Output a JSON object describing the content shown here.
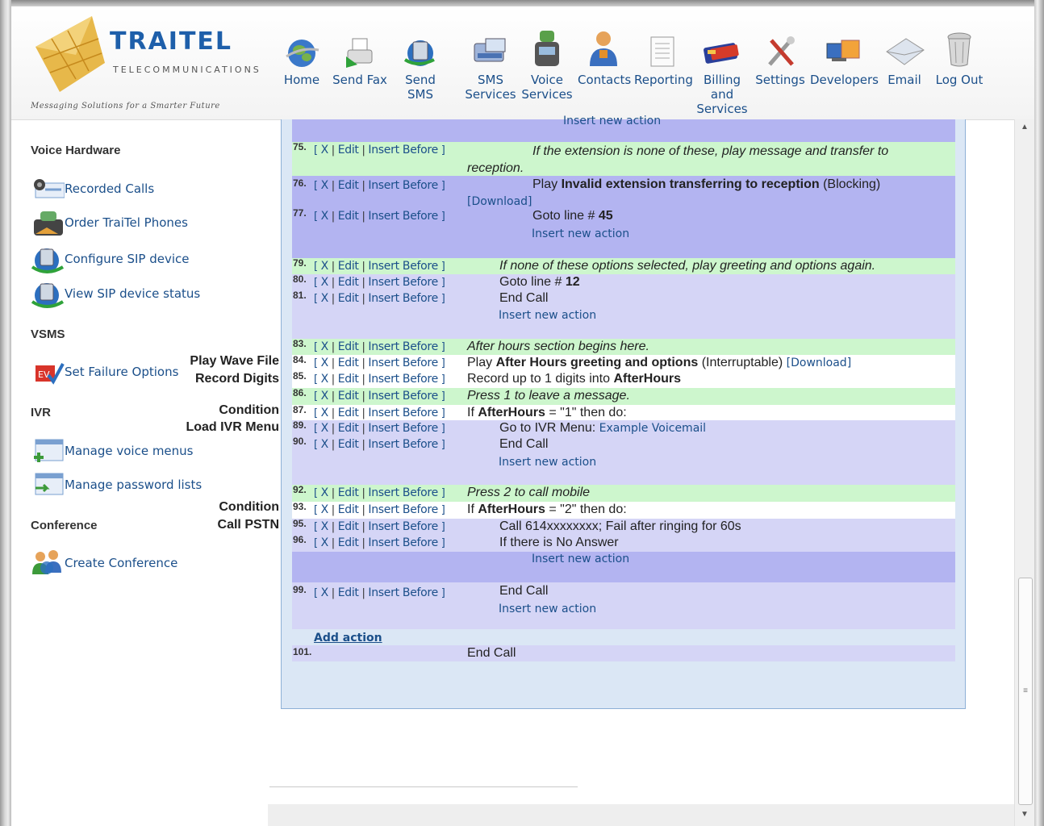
{
  "brand": {
    "name": "TRAITEL",
    "sub": "TELECOMMUNICATIONS",
    "tagline": "Messaging Solutions for a Smarter Future"
  },
  "nav": [
    {
      "label": "Home",
      "icon": "globe-icon"
    },
    {
      "label": "Send Fax",
      "icon": "fax-icon"
    },
    {
      "label": "Send SMS",
      "icon": "sms-icon"
    },
    {
      "label": "SMS Services",
      "icon": "sms-services-icon"
    },
    {
      "label": "Voice Services",
      "icon": "phone-icon"
    },
    {
      "label": "Contacts",
      "icon": "contacts-icon"
    },
    {
      "label": "Reporting",
      "icon": "report-icon"
    },
    {
      "label": "Billing and Services",
      "icon": "card-icon"
    },
    {
      "label": "Settings",
      "icon": "tools-icon"
    },
    {
      "label": "Developers",
      "icon": "developers-icon"
    },
    {
      "label": "Email",
      "icon": "envelope-icon"
    },
    {
      "label": "Log Out",
      "icon": "trash-icon"
    }
  ],
  "sidebar": {
    "voice_hardware": "Voice Hardware",
    "recorded_calls": "Recorded Calls",
    "order_phones": "Order TraiTel Phones",
    "configure_sip": "Configure SIP device",
    "view_sip": "View SIP device status",
    "vsms": "VSMS",
    "set_failure": "Set Failure Options",
    "ivr": "IVR",
    "manage_voice": "Manage voice menus",
    "manage_password": "Manage password lists",
    "conference": "Conference",
    "create_conference": "Create Conference"
  },
  "drag_labels": {
    "play_wave": "Play Wave File",
    "record_digits": "Record Digits",
    "condition1": "Condition",
    "load_ivr": "Load IVR Menu",
    "condition2": "Condition",
    "call_pstn": "Call PSTN"
  },
  "actions": {
    "open": "[",
    "x": "X",
    "edit": "Edit",
    "insert": "Insert Before",
    "close": "]",
    "bar": "|"
  },
  "insert_new_action": "Insert new action",
  "add_action": "Add action",
  "rows": {
    "r75": {
      "num": "75.",
      "text": "If the extension is none of these, play message and transfer to",
      "cont": "reception."
    },
    "r76": {
      "num": "76.",
      "pre": "Play ",
      "bold": "Invalid extension transferring to reception",
      "post": " (Blocking)",
      "download": "[Download]"
    },
    "r77": {
      "num": "77.",
      "pre": "Goto line # ",
      "bold": "45"
    },
    "r79": {
      "num": "79.",
      "text": "If none of these options selected, play greeting and options again."
    },
    "r80": {
      "num": "80.",
      "pre": "Goto line # ",
      "bold": "12"
    },
    "r81": {
      "num": "81.",
      "text": "End Call"
    },
    "r83": {
      "num": "83.",
      "text": "After hours section begins here."
    },
    "r84": {
      "num": "84.",
      "pre": "Play ",
      "bold": "After Hours greeting and options",
      "post": " (Interruptable) ",
      "download": "[Download]"
    },
    "r85": {
      "num": "85.",
      "pre": "Record up to 1 digits into ",
      "bold": "AfterHours"
    },
    "r86": {
      "num": "86.",
      "text": "Press 1 to leave a message."
    },
    "r87": {
      "num": "87.",
      "pre": "If ",
      "bold": "AfterHours",
      "post": " = \"1\" then do:"
    },
    "r89": {
      "num": "89.",
      "pre": "Go to IVR Menu: ",
      "link": "Example Voicemail"
    },
    "r90": {
      "num": "90.",
      "text": "End Call"
    },
    "r92": {
      "num": "92.",
      "text": "Press 2 to call mobile"
    },
    "r93": {
      "num": "93.",
      "pre": "If ",
      "bold": "AfterHours",
      "post": " = \"2\" then do:"
    },
    "r95": {
      "num": "95.",
      "text": "Call 614xxxxxxxx; Fail after ringing for 60s"
    },
    "r96": {
      "num": "96.",
      "text": "If there is No Answer"
    },
    "r99": {
      "num": "99.",
      "text": "End Call"
    },
    "r101": {
      "num": "101.",
      "text": "End Call"
    }
  }
}
